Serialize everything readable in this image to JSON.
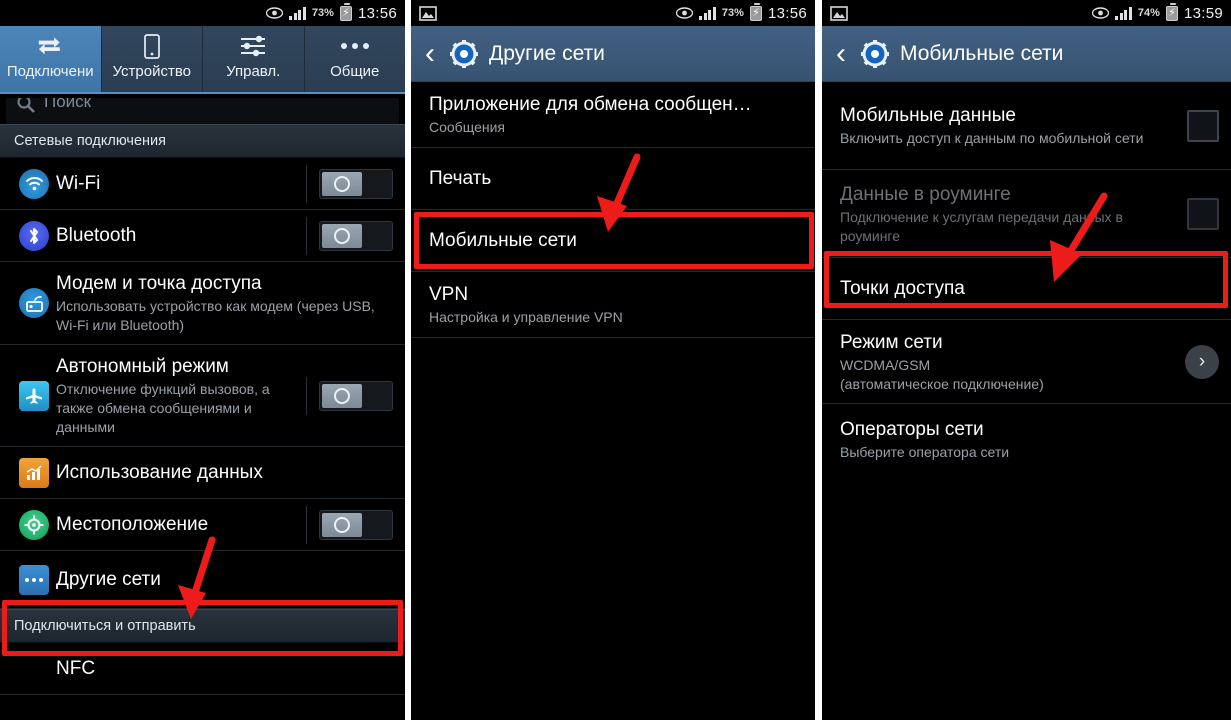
{
  "meta": {
    "accent_red": "#ee1b1b",
    "header_blue": "#3c5a7a",
    "active_tab_blue": "#4680b4"
  },
  "panel1": {
    "statusbar": {
      "eye_icon": "eye-icon",
      "signal_icon": "signal-bars-icon",
      "battery_percent": "73%",
      "battery_icon": "battery-charging-icon",
      "time": "13:56"
    },
    "tabs": [
      {
        "label": "Подключени",
        "icon": "connections-arrows-icon",
        "active": true
      },
      {
        "label": "Устройство",
        "icon": "phone-icon",
        "active": false
      },
      {
        "label": "Управл.",
        "icon": "sliders-icon",
        "active": false
      },
      {
        "label": "Общие",
        "icon": "dots-icon",
        "active": false
      }
    ],
    "search": {
      "placeholder": "Поиск",
      "icon": "search-icon"
    },
    "sections": [
      {
        "label": "Сетевые подключения"
      },
      {
        "label": "Подключиться и отправить"
      }
    ],
    "rows": [
      {
        "title": "Wi-Fi",
        "sub": "",
        "icon": "wifi-icon",
        "control": "switch"
      },
      {
        "title": "Bluetooth",
        "sub": "",
        "icon": "bluetooth-icon",
        "control": "switch"
      },
      {
        "title": "Модем и точка доступа",
        "sub": "Использовать устройство как модем (через USB, Wi-Fi или Bluetooth)",
        "icon": "tethering-icon",
        "control": "none"
      },
      {
        "title": "Автономный режим",
        "sub": "Отключение функций вызовов, а также обмена сообщениями и данными",
        "icon": "airplane-icon",
        "control": "switch"
      },
      {
        "title": "Использование данных",
        "sub": "",
        "icon": "data-usage-icon",
        "control": "none"
      },
      {
        "title": "Местоположение",
        "sub": "",
        "icon": "location-icon",
        "control": "switch"
      },
      {
        "title": "Другие сети",
        "sub": "",
        "icon": "more-networks-icon",
        "control": "none",
        "highlighted": true
      },
      {
        "title": "NFC",
        "sub": "",
        "icon": "nfc-icon",
        "control": "none"
      }
    ]
  },
  "panel2": {
    "statusbar": {
      "image_icon": "picture-icon",
      "eye_icon": "eye-icon",
      "signal_icon": "signal-bars-icon",
      "battery_percent": "73%",
      "battery_icon": "battery-charging-icon",
      "time": "13:56"
    },
    "header": {
      "back_icon": "back-chevron-icon",
      "gear_icon": "settings-gear-icon",
      "title": "Другие сети"
    },
    "rows": [
      {
        "title": "Приложение для обмена сообщен…",
        "sub": "Сообщения",
        "control": "none"
      },
      {
        "title": "Печать",
        "sub": "",
        "control": "none"
      },
      {
        "title": "Мобильные сети",
        "sub": "",
        "control": "none",
        "highlighted": true
      },
      {
        "title": "VPN",
        "sub": "Настройка и управление VPN",
        "control": "none"
      }
    ]
  },
  "panel3": {
    "statusbar": {
      "image_icon": "picture-icon",
      "eye_icon": "eye-icon",
      "signal_icon": "signal-bars-icon",
      "battery_percent": "74%",
      "battery_icon": "battery-charging-icon",
      "time": "13:59"
    },
    "header": {
      "back_icon": "back-chevron-icon",
      "gear_icon": "settings-gear-icon",
      "title": "Мобильные сети"
    },
    "rows": [
      {
        "title": "Мобильные данные",
        "sub": "Включить доступ к данным по мобильной сети",
        "control": "checkbox",
        "dim": false
      },
      {
        "title": "Данные в роуминге",
        "sub": "Подключение к услугам передачи данных в роуминге",
        "control": "checkbox",
        "dim": true
      },
      {
        "title": "Точки доступа",
        "sub": "",
        "control": "none",
        "highlighted": true
      },
      {
        "title": "Режим сети",
        "sub": "WCDMA/GSM\n(автоматическое подключение)",
        "control": "chevron",
        "chevron_icon": "chevron-right-icon"
      },
      {
        "title": "Операторы сети",
        "sub": "Выберите оператора сети",
        "control": "none"
      }
    ]
  }
}
